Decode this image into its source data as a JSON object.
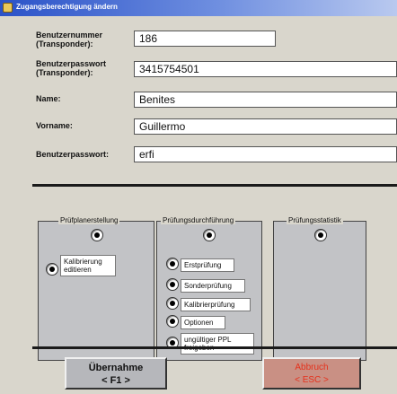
{
  "window": {
    "title": "Zugangsberechtigung ändern"
  },
  "form": {
    "user_number_label": "Benutzernummer (Transponder):",
    "user_number": "186",
    "user_password_tr_label": "Benutzerpasswort (Transponder):",
    "user_password_tr": "3415754501",
    "name_label": "Name:",
    "name": "Benites",
    "firstname_label": "Vorname:",
    "firstname": "Guillermo",
    "password_label": "Benutzerpasswort:",
    "password": "erfi"
  },
  "panels": {
    "planning": {
      "title": "Prüfplanerstellung",
      "options": [
        "Kalibrierung editieren"
      ]
    },
    "execution": {
      "title": "Prüfungsdurchführung",
      "options": [
        "Erstprüfung",
        "Sonderprüfung",
        "Kalibrierprüfung",
        "Optionen",
        "ungültiger PPL freigeben"
      ]
    },
    "statistics": {
      "title": "Prüfungsstatistik",
      "options": []
    }
  },
  "buttons": {
    "apply_label": "Übernahme",
    "apply_key": "< F1 >",
    "cancel_label": "Abbruch",
    "cancel_key": "< ESC >"
  }
}
